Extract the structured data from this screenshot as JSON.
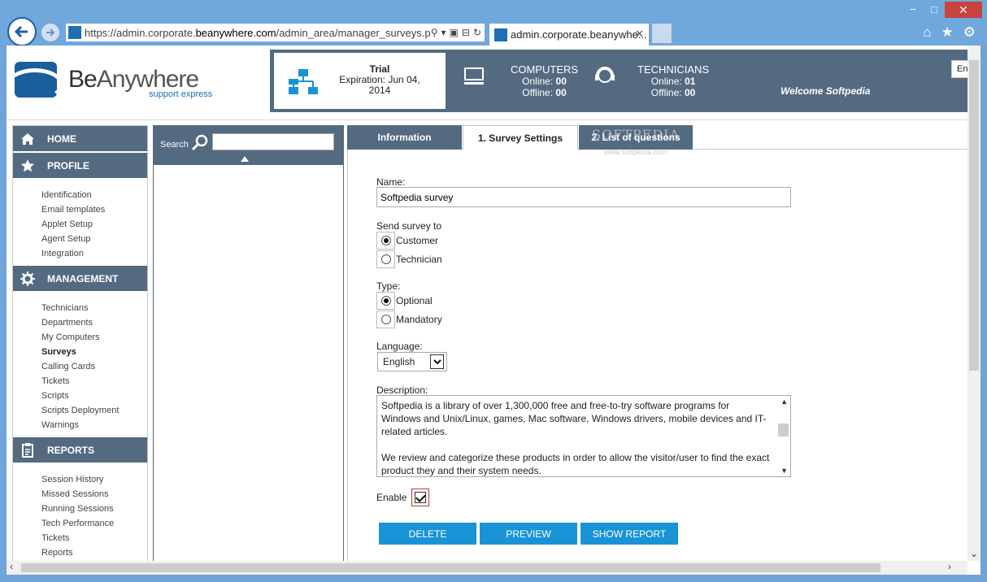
{
  "browser": {
    "url_prefix": "https://admin.corporate.",
    "url_domain": "beanywhere.com",
    "url_path": "/admin_area/manager_surveys.php",
    "tab_title": "admin.corporate.beanywhe...",
    "win_min": "−",
    "win_max": "□",
    "win_close": "✕",
    "tab_close": "✕"
  },
  "header": {
    "logo_be": "Be",
    "logo_anywhere": "Anywhere",
    "logo_sub": "support express",
    "trial_title": "Trial",
    "trial_expiration": "Expiration: Jun 04, 2014",
    "computers_title": "COMPUTERS",
    "computers_online_label": "Online:",
    "computers_online": "00",
    "computers_offline_label": "Offline:",
    "computers_offline": "00",
    "technicians_title": "TECHNICIANS",
    "technicians_online_label": "Online:",
    "technicians_online": "01",
    "technicians_offline_label": "Offline:",
    "technicians_offline": "00",
    "welcome": "Welcome Softpedia",
    "lang": "En"
  },
  "nav": {
    "home": "HOME",
    "profile": "PROFILE",
    "profile_items": [
      "Identification",
      "Email templates",
      "Applet Setup",
      "Agent Setup",
      "Integration"
    ],
    "management": "MANAGEMENT",
    "management_items": [
      "Technicians",
      "Departments",
      "My Computers",
      "Surveys",
      "Calling Cards",
      "Tickets",
      "Scripts",
      "Scripts Deployment",
      "Warnings"
    ],
    "reports": "REPORTS",
    "reports_items": [
      "Session History",
      "Missed Sessions",
      "Running Sessions",
      "Tech Performance",
      "Tickets",
      "Reports"
    ]
  },
  "search": {
    "label": "Search",
    "value": ""
  },
  "tabs": {
    "information": "Information",
    "survey_settings": "1. Survey Settings",
    "list_questions": "2. List of questions"
  },
  "form": {
    "name_label": "Name:",
    "name_value": "Softpedia survey",
    "send_label": "Send survey to",
    "send_customer": "Customer",
    "send_technician": "Technician",
    "type_label": "Type:",
    "type_optional": "Optional",
    "type_mandatory": "Mandatory",
    "language_label": "Language:",
    "language_value": "English",
    "description_label": "Description:",
    "description_value": "Softpedia is a library of over 1,300,000 free and free-to-try software programs for Windows and Unix/Linux, games, Mac software, Windows drivers, mobile devices and IT-related articles.\n\nWe review and categorize these products in order to allow the visitor/user to find the exact product they and their system needs.",
    "enable_label": "Enable",
    "enable_checked": true
  },
  "buttons": {
    "delete": "DELETE",
    "preview": "PREVIEW",
    "show_report": "SHOW REPORT"
  },
  "watermark": {
    "main": "SOFTPEDIA",
    "sub": "www.softpedia.com"
  },
  "colors": {
    "nav_bg": "#546a80",
    "button": "#1a93d6",
    "chrome": "#6fa8dc"
  }
}
